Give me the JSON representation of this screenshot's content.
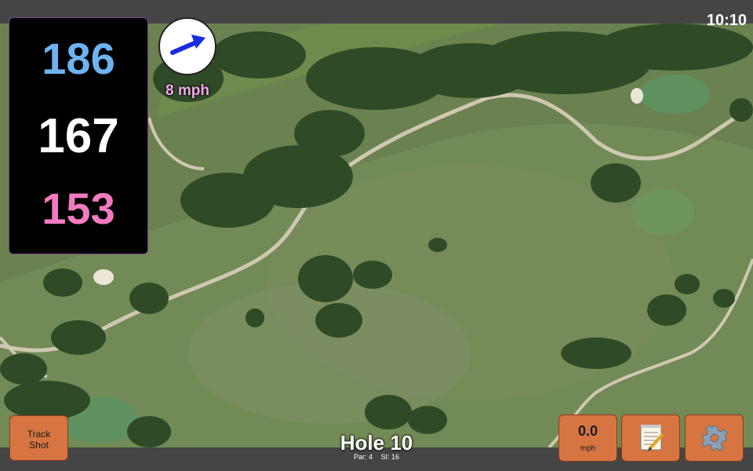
{
  "status": {
    "time": "10:10"
  },
  "yardages": {
    "back": "186",
    "center": "167",
    "front": "153"
  },
  "wind": {
    "speed_label": "8 mph",
    "icon": "wind-arrow-icon"
  },
  "hole": {
    "title": "Hole 10",
    "par": "Par: 4",
    "stroke_index": "SI: 16"
  },
  "buttons": {
    "track_shot_line1": "Track",
    "track_shot_line2": "Shot",
    "speed_value": "0.0",
    "speed_unit": "mph",
    "notes_icon": "notepad-icon",
    "settings_icon": "gear-icon"
  },
  "colors": {
    "back_yardage": "#6db3f2",
    "center_yardage": "#ffffff",
    "front_yardage": "#f27ac1",
    "button_bg": "#d67541",
    "wind_text": "#f5a8e8"
  }
}
